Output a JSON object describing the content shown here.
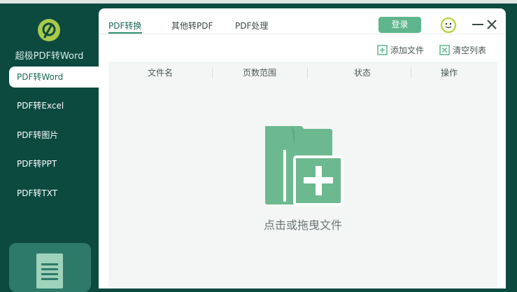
{
  "app": {
    "name": "超极PDF转Word"
  },
  "sidebar": {
    "items": [
      {
        "label": "PDF转Word",
        "active": true
      },
      {
        "label": "PDF转Excel",
        "active": false
      },
      {
        "label": "PDF转图片",
        "active": false
      },
      {
        "label": "PDF转PPT",
        "active": false
      },
      {
        "label": "PDF转TXT",
        "active": false
      }
    ]
  },
  "tabs": [
    {
      "label": "PDF转换",
      "active": true
    },
    {
      "label": "其他转PDF",
      "active": false
    },
    {
      "label": "PDF处理",
      "active": false
    }
  ],
  "header": {
    "login_label": "登录"
  },
  "actions": {
    "add_file": "添加文件",
    "clear_list": "清空列表"
  },
  "table": {
    "columns": [
      "文件名",
      "页数范围",
      "状态",
      "操作"
    ]
  },
  "dropzone": {
    "text": "点击或拖曳文件"
  },
  "colors": {
    "sidebar_bg": "#0c4a40",
    "accent": "#5fb58c",
    "folder": "#6cb98f"
  },
  "icons": {
    "logo": "logo-icon",
    "add_file": "add-file-icon",
    "clear_list": "clear-list-icon",
    "face": "smiley-icon",
    "minimize": "minimize-icon",
    "close": "close-icon",
    "folder": "folder-plus-icon",
    "document": "document-icon"
  }
}
